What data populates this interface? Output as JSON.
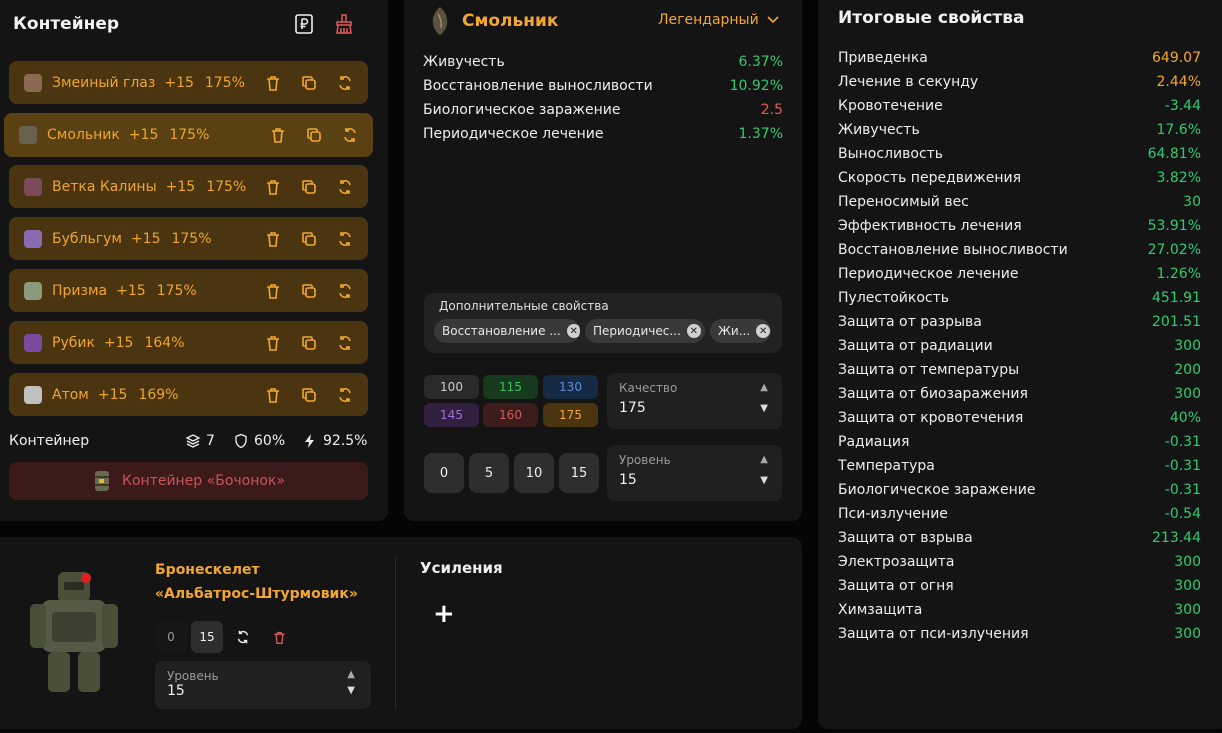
{
  "container": {
    "title": "Контейнер",
    "artifacts": [
      {
        "name": "Змеиный глаз",
        "level": "+15",
        "quality": "175%",
        "color": "#8a6a50"
      },
      {
        "name": "Смольник",
        "level": "+15",
        "quality": "175%",
        "color": "#6a6250"
      },
      {
        "name": "Ветка Калины",
        "level": "+15",
        "quality": "175%",
        "color": "#7a4a5a"
      },
      {
        "name": "Бубльгум",
        "level": "+15",
        "quality": "175%",
        "color": "#8a6ab0"
      },
      {
        "name": "Призма",
        "level": "+15",
        "quality": "175%",
        "color": "#8a9a7a"
      },
      {
        "name": "Рубик",
        "level": "+15",
        "quality": "164%",
        "color": "#7a4aa0"
      },
      {
        "name": "Атом",
        "level": "+15",
        "quality": "169%",
        "color": "#c0c0c0"
      }
    ],
    "footer_label": "Контейнер",
    "slots": "7",
    "protection": "60%",
    "efficiency": "92.5%",
    "barrel_button": "Контейнер «Бочонок»"
  },
  "artifact": {
    "name": "Смольник",
    "rarity": "Легендарный",
    "props": [
      {
        "name": "Живучесть",
        "value": "6.37%",
        "color": "green"
      },
      {
        "name": "Восстановление выносливости",
        "value": "10.92%",
        "color": "green"
      },
      {
        "name": "Биологическое заражение",
        "value": "2.5",
        "color": "red"
      },
      {
        "name": "Периодическое лечение",
        "value": "1.37%",
        "color": "green"
      }
    ],
    "extra_label": "Дополнительные свойства",
    "chips": [
      "Восстановление ...",
      "Периодичес...",
      "Жи..."
    ],
    "quality_buttons": [
      {
        "label": "100",
        "bg": "#2a2a2a",
        "fg": "#cfcfcf"
      },
      {
        "label": "115",
        "bg": "#173a1f",
        "fg": "#3fbf5f"
      },
      {
        "label": "130",
        "bg": "#162a45",
        "fg": "#5a8fd8"
      },
      {
        "label": "145",
        "bg": "#32203f",
        "fg": "#a070d8"
      },
      {
        "label": "160",
        "bg": "#3d1c1c",
        "fg": "#d05a5a"
      },
      {
        "label": "175",
        "bg": "#4a3510",
        "fg": "#f2a830"
      }
    ],
    "quality_select": {
      "label": "Качество",
      "value": "175"
    },
    "level_buttons": [
      "0",
      "5",
      "10",
      "15"
    ],
    "level_select": {
      "label": "Уровень",
      "value": "15"
    }
  },
  "exoskeleton": {
    "name_line1": "Бронескелет",
    "name_line2": "«Альбатрос-Штурмовик»",
    "btn_0": "0",
    "btn_15": "15",
    "level_select": {
      "label": "Уровень",
      "value": "15"
    },
    "boosts_title": "Усиления",
    "add_symbol": "+"
  },
  "totals": {
    "title": "Итоговые свойства",
    "rows": [
      {
        "name": "Приведенка",
        "value": "649.07",
        "color": "orange"
      },
      {
        "name": "Лечение в секунду",
        "value": "2.44%",
        "color": "orange"
      },
      {
        "name": "Кровотечение",
        "value": "-3.44",
        "color": "green"
      },
      {
        "name": "Живучесть",
        "value": "17.6%",
        "color": "green"
      },
      {
        "name": "Выносливость",
        "value": "64.81%",
        "color": "green"
      },
      {
        "name": "Скорость передвижения",
        "value": "3.82%",
        "color": "green"
      },
      {
        "name": "Переносимый вес",
        "value": "30",
        "color": "green"
      },
      {
        "name": "Эффективность лечения",
        "value": "53.91%",
        "color": "green"
      },
      {
        "name": "Восстановление выносливости",
        "value": "27.02%",
        "color": "green"
      },
      {
        "name": "Периодическое лечение",
        "value": "1.26%",
        "color": "green"
      },
      {
        "name": "Пулестойкость",
        "value": "451.91",
        "color": "green"
      },
      {
        "name": "Защита от разрыва",
        "value": "201.51",
        "color": "green"
      },
      {
        "name": "Защита от радиации",
        "value": "300",
        "color": "green"
      },
      {
        "name": "Защита от температуры",
        "value": "200",
        "color": "green"
      },
      {
        "name": "Защита от биозаражения",
        "value": "300",
        "color": "green"
      },
      {
        "name": "Защита от кровотечения",
        "value": "40%",
        "color": "green"
      },
      {
        "name": "Радиация",
        "value": "-0.31",
        "color": "green"
      },
      {
        "name": "Температура",
        "value": "-0.31",
        "color": "green"
      },
      {
        "name": "Биологическое заражение",
        "value": "-0.31",
        "color": "green"
      },
      {
        "name": "Пси-излучение",
        "value": "-0.54",
        "color": "green"
      },
      {
        "name": "Защита от взрыва",
        "value": "213.44",
        "color": "green"
      },
      {
        "name": "Электрозащита",
        "value": "300",
        "color": "green"
      },
      {
        "name": "Защита от огня",
        "value": "300",
        "color": "green"
      },
      {
        "name": "Химзащита",
        "value": "300",
        "color": "green"
      },
      {
        "name": "Защита от пси-излучения",
        "value": "300",
        "color": "green"
      }
    ]
  },
  "colors": {
    "accent": "#f2a830",
    "green": "#2ecc71",
    "red": "#e05a5a",
    "panel": "#141414"
  }
}
